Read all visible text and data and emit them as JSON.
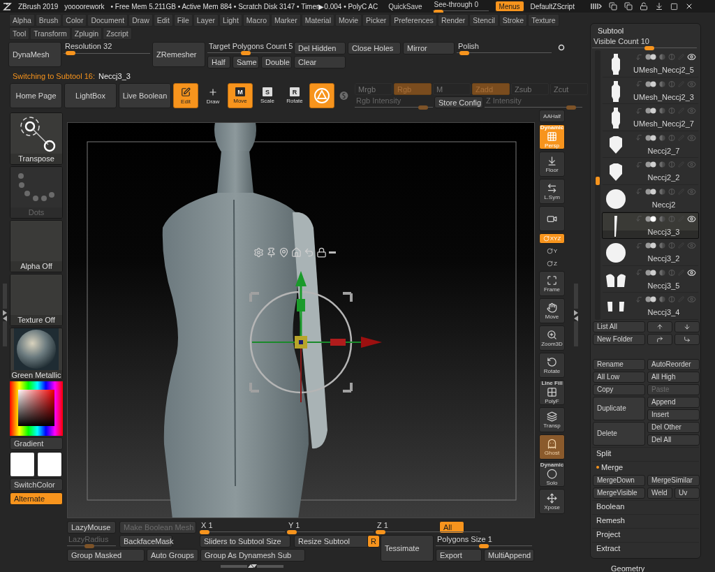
{
  "title_bar": {
    "app": "ZBrush 2019",
    "file": "yoooorework",
    "stats": "• Free Mem 5.211GB • Active Mem 884 • Scratch Disk 3147 • Timer▶0.004 • PolyC AC",
    "quicksave": "QuickSave",
    "see_through": {
      "label": "See-through  0",
      "level": 0.02
    },
    "menus": {
      "label": "Menus",
      "on": true
    },
    "script": "DefaultZScript"
  },
  "menu_rows": [
    [
      "Alpha",
      "Brush",
      "Color",
      "Document",
      "Draw",
      "Edit",
      "File",
      "Layer",
      "Light",
      "Macro",
      "Marker",
      "Material",
      "Movie",
      "Picker",
      "Preferences",
      "Render",
      "Stencil",
      "Stroke",
      "Texture"
    ],
    [
      "Tool",
      "Transform",
      "Zplugin",
      "Zscript"
    ]
  ],
  "geometry_bar": {
    "dynamesh": "DynaMesh",
    "resolution": {
      "label": "Resolution 32",
      "level": 0.03
    },
    "zremesher": "ZRemesher",
    "target_polygons": {
      "label": "Target Polygons Count 5",
      "level": 0.45
    },
    "half": "Half",
    "same": "Same",
    "double": "Double",
    "del_hidden": "Del Hidden",
    "clear": "Clear",
    "close_holes": "Close Holes",
    "mirror": "Mirror",
    "polish": {
      "label": "Polish",
      "level": 0.03
    }
  },
  "notice": {
    "message": "Switching to Subtool 16:",
    "subtool": "Neccj3_3"
  },
  "top_shelf": {
    "home": "Home Page",
    "lightbox": "LightBox",
    "live_boolean": "Live Boolean",
    "tools": [
      {
        "kind": "edit",
        "label": "Edit",
        "on": true
      },
      {
        "kind": "draw",
        "label": "Draw",
        "on": false
      },
      {
        "kind": "move",
        "label": "Move",
        "glyph": "M",
        "on": true
      },
      {
        "kind": "scale",
        "label": "Scale",
        "glyph": "S",
        "on": false
      },
      {
        "kind": "rotate",
        "label": "Rotate",
        "glyph": "R",
        "on": false
      }
    ],
    "gizmo": {
      "on": true
    },
    "modes_disabled": true,
    "modes": [
      {
        "label": "Mrgb",
        "on": false
      },
      {
        "label": "Rgb",
        "on": true
      },
      {
        "label": "M",
        "on": false
      },
      {
        "label": "Zadd",
        "on": true
      },
      {
        "label": "Zsub",
        "on": false
      },
      {
        "label": "Zcut",
        "on": false
      }
    ],
    "rgb_intensity": {
      "label": "Rgb Intensity",
      "level": 0.93
    },
    "store_config": "Store Config",
    "z_intensity": {
      "label": "Z Intensity",
      "level": 0.93
    }
  },
  "left_shelf": {
    "items": [
      {
        "kind": "transpose",
        "label": "Transpose",
        "disabled": false
      },
      {
        "kind": "dots",
        "label": "Dots",
        "disabled": true
      },
      {
        "kind": "blank",
        "label": "Alpha Off",
        "disabled": false
      },
      {
        "kind": "blank",
        "label": "Texture Off",
        "disabled": false
      },
      {
        "kind": "material",
        "label": "Green Metallic",
        "disabled": false
      }
    ],
    "gradient": "Gradient",
    "switch_color": "SwitchColor",
    "alternate": {
      "label": "Alternate",
      "on": true
    }
  },
  "right_shelf": [
    {
      "kind": "aahalf",
      "label": "AAHalf",
      "on": false,
      "disabled": false
    },
    {
      "kind": "persp",
      "label": "Persp",
      "caption": "Dynamic",
      "on": true,
      "disabled": false
    },
    {
      "kind": "floor",
      "label": "Floor",
      "on": false,
      "disabled": false
    },
    {
      "kind": "lsym",
      "label": "L.Sym",
      "on": false,
      "disabled": false
    },
    {
      "kind": "camlock",
      "on": false,
      "disabled": false
    },
    {
      "kind": "axis",
      "label": "XYZ",
      "on": true,
      "disabled": false
    },
    {
      "kind": "axis",
      "label": "Y",
      "on": false,
      "disabled": false
    },
    {
      "kind": "axis",
      "label": "Z",
      "on": false,
      "disabled": false
    },
    {
      "kind": "frame",
      "label": "Frame",
      "on": false,
      "disabled": false
    },
    {
      "kind": "move",
      "label": "Move",
      "on": false,
      "disabled": false
    },
    {
      "kind": "zoom",
      "label": "Zoom3D",
      "on": false,
      "disabled": false
    },
    {
      "kind": "rotate",
      "label": "Rotate",
      "on": false,
      "disabled": false
    },
    {
      "kind": "polyf",
      "label": "PolyF",
      "caption": "Line Fill",
      "on": false,
      "disabled": false
    },
    {
      "kind": "transp",
      "label": "Transp",
      "on": false,
      "disabled": false
    },
    {
      "kind": "ghost",
      "label": "Ghost",
      "on": true,
      "disabled": true
    },
    {
      "kind": "solo",
      "label": "Solo",
      "caption": "Dynamic",
      "on": false,
      "disabled": false
    },
    {
      "kind": "xpose",
      "label": "Xpose",
      "on": false,
      "disabled": false
    }
  ],
  "bottom_shelf": {
    "lazymouse": "LazyMouse",
    "make_boolean": {
      "label": "Make Boolean Mesh",
      "disabled": true
    },
    "x": {
      "label": "X 1",
      "level": 0.0
    },
    "y": {
      "label": "Y 1",
      "level": 0.0
    },
    "z": {
      "label": "Z 1",
      "level": 0.0
    },
    "all": {
      "label": "All",
      "on": true
    },
    "lazyradius": {
      "label": "LazyRadius",
      "level": 0.45,
      "disabled": true
    },
    "backface": "BackfaceMask",
    "sliders_to_size": "Sliders to Subtool Size",
    "resize": "Resize Subtool",
    "r": {
      "label": "R",
      "on": true
    },
    "tessimate": "Tessimate",
    "polygons_size": {
      "label": "Polygons Size 1",
      "level": 0.5
    },
    "group_masked": "Group Masked",
    "auto_groups": "Auto Groups",
    "group_dynamesh": "Group As Dynamesh Sub",
    "export": "Export",
    "multiappend": "MultiAppend"
  },
  "subtool": {
    "title": "Subtool",
    "visible_count": {
      "label": "Visible Count 10",
      "level": 0.55
    },
    "items": [
      {
        "name": "UMesh_Neccj2_5",
        "kind": "torso",
        "selected": false,
        "visible": true
      },
      {
        "name": "UMesh_Neccj2_3",
        "kind": "torso",
        "selected": false,
        "visible": false
      },
      {
        "name": "UMesh_Neccj2_7",
        "kind": "torso",
        "selected": false,
        "visible": false
      },
      {
        "name": "Neccj2_7",
        "kind": "bust",
        "selected": false,
        "visible": false
      },
      {
        "name": "Neccj2_2",
        "kind": "bust",
        "selected": false,
        "visible": false
      },
      {
        "name": "Neccj2",
        "kind": "sphere",
        "selected": false,
        "visible": false
      },
      {
        "name": "Neccj3_3",
        "kind": "strip",
        "selected": true,
        "visible": true
      },
      {
        "name": "Neccj3_2",
        "kind": "sphere",
        "selected": false,
        "visible": false
      },
      {
        "name": "Neccj3_5",
        "kind": "pair",
        "selected": false,
        "visible": true
      },
      {
        "name": "Neccj3_4",
        "kind": "small_pair",
        "selected": false,
        "visible": false
      }
    ],
    "list_all": "List All",
    "new_folder": "New Folder",
    "rename": "Rename",
    "auto_reorder": "AutoReorder",
    "all_low": "All Low",
    "all_high": "All High",
    "copy": "Copy",
    "paste": {
      "label": "Paste",
      "disabled": true
    },
    "duplicate": "Duplicate",
    "append": "Append",
    "insert": "Insert",
    "delete": "Delete",
    "del_other": "Del Other",
    "del_all": "Del All",
    "split": "Split",
    "merge": {
      "label": "Merge",
      "expanded": true
    },
    "merge_down": "MergeDown",
    "merge_similar": "MergeSimilar",
    "merge_visible": "MergeVisible",
    "weld": "Weld",
    "uv": "Uv",
    "sections": [
      "Boolean",
      "Remesh",
      "Project",
      "Extract"
    ]
  },
  "geometry": "Geometry"
}
